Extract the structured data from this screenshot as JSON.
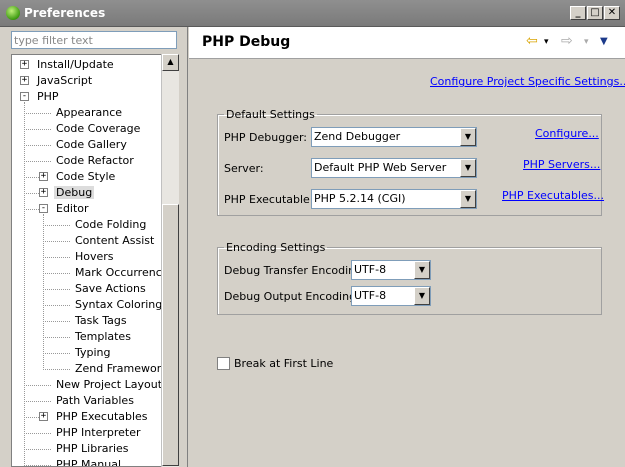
{
  "window": {
    "title": "Preferences",
    "min_glyph": "_",
    "max_glyph": "□",
    "close_glyph": "✕"
  },
  "filter": {
    "placeholder": "type filter text",
    "value": ""
  },
  "tree": [
    {
      "label": "Install/Update",
      "depth": 0,
      "expander": "+"
    },
    {
      "label": "JavaScript",
      "depth": 0,
      "expander": "+"
    },
    {
      "label": "PHP",
      "depth": 0,
      "expander": "-"
    },
    {
      "label": "Appearance",
      "depth": 1,
      "expander": ""
    },
    {
      "label": "Code Coverage",
      "depth": 1,
      "expander": ""
    },
    {
      "label": "Code Gallery",
      "depth": 1,
      "expander": ""
    },
    {
      "label": "Code Refactor",
      "depth": 1,
      "expander": ""
    },
    {
      "label": "Code Style",
      "depth": 1,
      "expander": "+"
    },
    {
      "label": "Debug",
      "depth": 1,
      "expander": "+",
      "selected": true
    },
    {
      "label": "Editor",
      "depth": 1,
      "expander": "-"
    },
    {
      "label": "Code Folding",
      "depth": 2,
      "expander": ""
    },
    {
      "label": "Content Assist",
      "depth": 2,
      "expander": ""
    },
    {
      "label": "Hovers",
      "depth": 2,
      "expander": ""
    },
    {
      "label": "Mark Occurrences",
      "depth": 2,
      "expander": ""
    },
    {
      "label": "Save Actions",
      "depth": 2,
      "expander": ""
    },
    {
      "label": "Syntax Coloring",
      "depth": 2,
      "expander": ""
    },
    {
      "label": "Task Tags",
      "depth": 2,
      "expander": ""
    },
    {
      "label": "Templates",
      "depth": 2,
      "expander": ""
    },
    {
      "label": "Typing",
      "depth": 2,
      "expander": ""
    },
    {
      "label": "Zend Framework",
      "depth": 2,
      "expander": ""
    },
    {
      "label": "New Project Layout",
      "depth": 1,
      "expander": ""
    },
    {
      "label": "Path Variables",
      "depth": 1,
      "expander": ""
    },
    {
      "label": "PHP Executables",
      "depth": 1,
      "expander": "+"
    },
    {
      "label": "PHP Interpreter",
      "depth": 1,
      "expander": ""
    },
    {
      "label": "PHP Libraries",
      "depth": 1,
      "expander": ""
    },
    {
      "label": "PHP Manual",
      "depth": 1,
      "expander": ""
    }
  ],
  "page": {
    "title": "PHP Debug",
    "nav": {
      "back": "⇦",
      "forward": "⇨",
      "menu": "▼",
      "dropdown": "▾"
    },
    "configure_project_link": "Configure Project Specific Settings...",
    "default_settings": {
      "legend": "Default Settings",
      "debugger_label": "PHP Debugger:",
      "debugger_value": "Zend Debugger",
      "debugger_link": "Configure...",
      "server_label": "Server:",
      "server_value": "Default PHP Web Server",
      "server_link": "PHP Servers...",
      "executable_label": "PHP Executable:",
      "executable_value": "PHP 5.2.14 (CGI)",
      "executable_link": "PHP Executables..."
    },
    "encoding_settings": {
      "legend": "Encoding Settings",
      "transfer_label": "Debug Transfer Encoding",
      "transfer_value": "UTF-8",
      "output_label": "Debug Output Encoding",
      "output_value": "UTF-8"
    },
    "break_first_line": {
      "label": "Break at First Line",
      "checked": false
    }
  }
}
